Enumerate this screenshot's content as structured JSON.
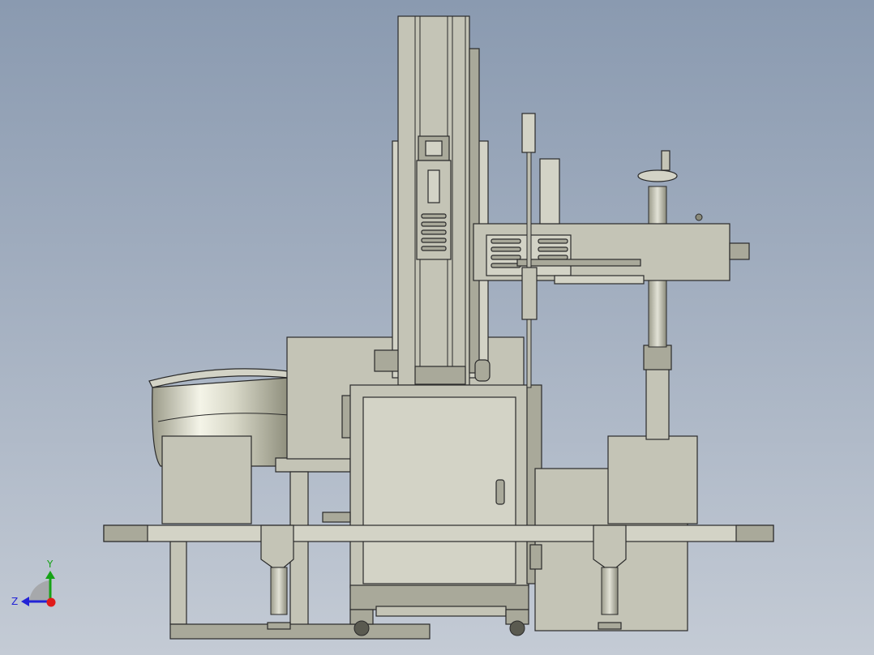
{
  "triad": {
    "y_label": "Y",
    "z_label": "Z",
    "colors": {
      "y": "#16a216",
      "z": "#2323d6",
      "x": "#e01a1a"
    }
  },
  "model_colors": {
    "body": "#c4c4b6",
    "shadow": "#a9a99a",
    "edge": "#2a2a2a",
    "background_top": "#8a9ab0",
    "background_bottom": "#c4cbd5"
  }
}
